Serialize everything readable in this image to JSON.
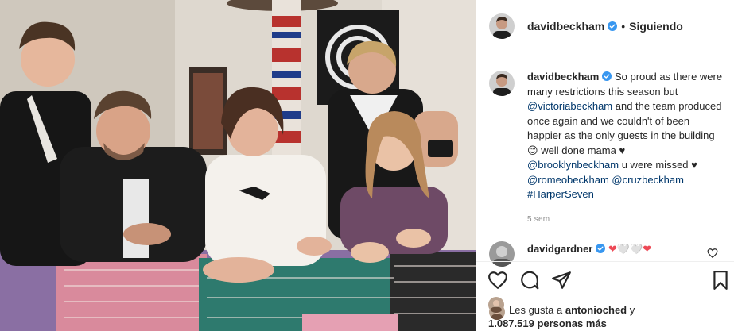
{
  "post": {
    "author": "davidbeckham",
    "follow_label": "Siguiendo",
    "separator": "•"
  },
  "caption": {
    "author": "davidbeckham",
    "text1": "So proud as there were many restrictions this season but",
    "mention1": "@victoriabeckham",
    "text2": "and the team produced once again and we couldn't of been happier as the only guests in the building",
    "emoji1": "😊",
    "text3": "well done mama",
    "heart1": "♥",
    "mention2": "@brooklynbeckham",
    "text4": "u were missed",
    "heart2": "♥",
    "mention3": "@romeobeckham",
    "mention4": "@cruzbeckham",
    "hashtag": "#HarperSeven",
    "time": "5 sem"
  },
  "comment": {
    "author": "davidgardner",
    "text": "❤🤍🤍❤"
  },
  "likes": {
    "prefix": "Les gusta a",
    "user": "antonioched",
    "connector": "y",
    "count": "1.087.519 personas más"
  },
  "colors": {
    "link": "#00376b",
    "verified": "#3897f0",
    "text": "#262626",
    "muted": "#8e8e8e",
    "heart": "#ed4956"
  },
  "icons": [
    "verified-badge-icon",
    "heart-icon",
    "comment-icon",
    "share-icon",
    "bookmark-icon",
    "like-outline-icon"
  ]
}
